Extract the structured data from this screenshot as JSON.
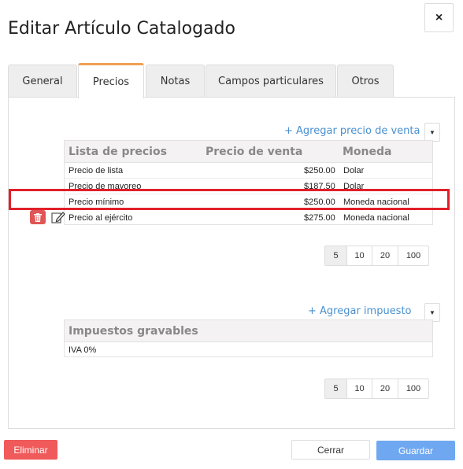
{
  "dialog": {
    "title": "Editar Artículo Catalogado",
    "close_label": "×"
  },
  "tabs": [
    {
      "label": "General"
    },
    {
      "label": "Precios"
    },
    {
      "label": "Notas"
    },
    {
      "label": "Campos particulares"
    },
    {
      "label": "Otros"
    }
  ],
  "prices": {
    "add_label": "+ Agregar precio de venta",
    "columns": [
      "Lista de precios",
      "Precio de venta",
      "Moneda"
    ],
    "rows": [
      {
        "list": "Precio de lista",
        "price": "$250.00",
        "currency": "Dolar"
      },
      {
        "list": "Precio de mayoreo",
        "price": "$187.50",
        "currency": "Dolar"
      },
      {
        "list": "Precio mínimo",
        "price": "$250.00",
        "currency": "Moneda nacional"
      },
      {
        "list": "Precio al ejército",
        "price": "$275.00",
        "currency": "Moneda nacional"
      }
    ],
    "pager": [
      "5",
      "10",
      "20",
      "100"
    ]
  },
  "taxes": {
    "add_label": "+ Agregar impuesto",
    "column": "Impuestos gravables",
    "rows": [
      {
        "name": "IVA 0%"
      }
    ],
    "pager": [
      "5",
      "10",
      "20",
      "100"
    ]
  },
  "footer": {
    "delete_label": "Eliminar",
    "close_label": "Cerrar",
    "save_label": "Guardar"
  },
  "colors": {
    "delete": "#f05a5a",
    "save": "#6fa8f0",
    "highlight": "#e0202a",
    "active_tab_border": "#f0a050"
  }
}
